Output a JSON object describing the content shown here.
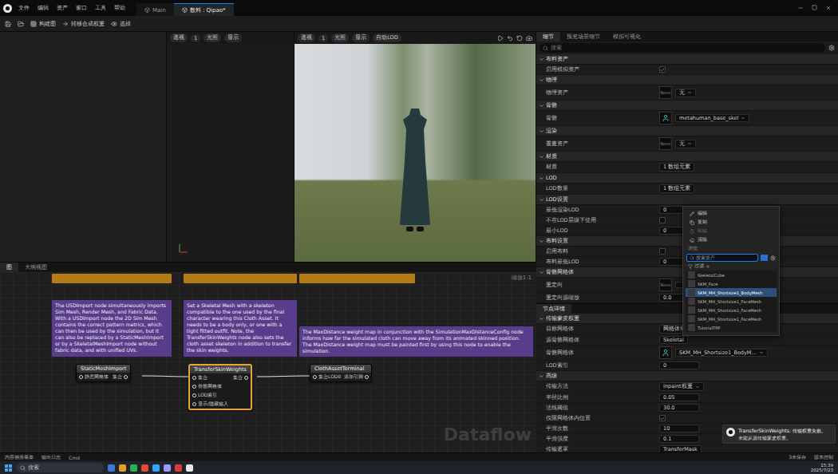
{
  "menu": [
    "文件",
    "编辑",
    "资产",
    "窗口",
    "工具",
    "帮助"
  ],
  "doc_tabs": [
    {
      "label": "Main",
      "selected": false
    },
    {
      "label": "数料 : Qipao*",
      "selected": true
    }
  ],
  "toolbar": [
    "构建图",
    "转移合成权重",
    "选择"
  ],
  "viewport_left": {
    "buttons": [
      "透视",
      "1",
      "光照",
      "显示"
    ]
  },
  "viewport_right": {
    "buttons": [
      "透视",
      "1",
      "光照",
      "显示",
      "自动LOD"
    ]
  },
  "graph": {
    "tabs": [
      {
        "label": "图",
        "selected": true
      },
      {
        "label": "大纲视图",
        "selected": false
      }
    ],
    "zoom": "缩放1:1",
    "watermark": "Dataflow",
    "comments": [
      "The USDImport node simultaneously imports Sim Mesh, Render Mesh, and Fabric Data. With a USDImport node the 2D Sim Mesh contains the correct pattern metrics, which can then be used by the simulation, but it can also be replaced by a StaticMeshImport or by a SkeletalMeshImport node without fabric data, and with unified UVs.",
      "Set a Skeletal Mesh with a skeleton compatible to the one used by the final character wearing this Cloth Asset. It needs to be a body only, or one with a tight fitted outfit. Note, the TransferSkinWeights node also sets the cloth asset skeleton in addition to transfer the skin weights.",
      "The MaxDistance weight map in conjunction with the SimulationMaxDistanceConfig node informs how far the simulated cloth can move away from its animated skinned position. The MaxDistance weight map must be painted first by using this node to enable the simulation."
    ],
    "nodes": [
      {
        "title": "StaticMeshImport",
        "selected": false,
        "inputs": [
          "静态网格体"
        ],
        "outputs": [
          "集合"
        ]
      },
      {
        "title": "TransferSkinWeights",
        "selected": true,
        "inputs": [
          "集合",
          "骨骼网格体",
          "LOD索引",
          "显示/隐藏输入"
        ],
        "outputs": [
          "集合"
        ]
      },
      {
        "title": "ClothAssetTerminal",
        "selected": false,
        "inputs": [
          "集合LOD0"
        ],
        "outputs": [
          "添加引脚"
        ]
      }
    ]
  },
  "details": {
    "tabs": [
      {
        "label": "细节",
        "selected": true
      },
      {
        "label": "预览场景细节",
        "selected": false
      },
      {
        "label": "模拟可视化",
        "selected": false
      }
    ],
    "search": "搜索",
    "rows": [
      {
        "kind": "header",
        "label": "布料资产"
      },
      {
        "kind": "check",
        "label": "启用模拟资产",
        "checked": true
      },
      {
        "kind": "header",
        "label": "物理"
      },
      {
        "kind": "asset",
        "label": "物理资产",
        "thumb": "None",
        "value": "无"
      },
      {
        "kind": "header",
        "label": "骨骼"
      },
      {
        "kind": "asset",
        "label": "骨骼",
        "thumb": "",
        "value": "metahuman_base_skel"
      },
      {
        "kind": "header",
        "label": "渲染"
      },
      {
        "kind": "asset",
        "label": "覆盖资产",
        "thumb": "None",
        "value": "无"
      },
      {
        "kind": "header",
        "label": "材质"
      },
      {
        "kind": "text",
        "label": "材质",
        "value": "1 数组元素"
      },
      {
        "kind": "header",
        "label": "LOD"
      },
      {
        "kind": "text",
        "label": "LOD数量",
        "value": "1 数组元素"
      },
      {
        "kind": "header",
        "label": "LOD设置"
      },
      {
        "kind": "number",
        "label": "最低渲染LOD",
        "value": "0"
      },
      {
        "kind": "check",
        "label": "不在LOD层级下使用",
        "checked": false
      },
      {
        "kind": "number",
        "label": "最小LOD",
        "value": "0"
      },
      {
        "kind": "header",
        "label": "布料设置"
      },
      {
        "kind": "check",
        "label": "启用布料",
        "checked": false
      },
      {
        "kind": "number",
        "label": "布料最低LOD",
        "value": "0"
      },
      {
        "kind": "header",
        "label": "骨骼网格体"
      },
      {
        "kind": "asset",
        "label": "重定向",
        "thumb": "None",
        "value": ""
      },
      {
        "kind": "number",
        "label": "重定向源缩放",
        "value": "0.0"
      }
    ]
  },
  "node_details": {
    "title": "节点详情",
    "rows": [
      {
        "kind": "header",
        "label": "传输蒙皮权重"
      },
      {
        "kind": "text",
        "label": "目标网格体",
        "value": "网格体集合"
      },
      {
        "kind": "text",
        "label": "源骨骼网格体",
        "value": "Skeletal"
      },
      {
        "kind": "asset",
        "label": "骨骼网格体",
        "thumb": "",
        "value": "SKM_MH_Shortsize1_BodyM..."
      },
      {
        "kind": "number",
        "label": "LOD索引",
        "value": "0"
      },
      {
        "kind": "header",
        "label": "高级"
      },
      {
        "kind": "select",
        "label": "传输方法",
        "value": "Inpaint权重"
      },
      {
        "kind": "number",
        "label": "半径比例",
        "value": "0.05"
      },
      {
        "kind": "number",
        "label": "法线阈值",
        "value": "30.0"
      },
      {
        "kind": "check",
        "label": "仅限网格体内位置",
        "checked": true
      },
      {
        "kind": "number",
        "label": "平滑次数",
        "value": "10"
      },
      {
        "kind": "number",
        "label": "平滑强度",
        "value": "0.1"
      },
      {
        "kind": "text",
        "label": "传输遮罩",
        "value": "TransferMask"
      }
    ]
  },
  "asset_picker": {
    "actions": [
      {
        "label": "编辑",
        "disabled": false
      },
      {
        "label": "复制",
        "disabled": false
      },
      {
        "label": "粘贴",
        "disabled": true
      },
      {
        "label": "清除",
        "disabled": false
      }
    ],
    "section": "浏览",
    "search": "搜索资产",
    "filter": "过滤",
    "items": [
      {
        "label": "SkeletalCube",
        "selected": false
      },
      {
        "label": "SKM_Face",
        "selected": false
      },
      {
        "label": "SKM_MH_Shortsize1_BodyMesh",
        "selected": true
      },
      {
        "label": "SKM_MH_Shortsize1_FaceMesh",
        "selected": false
      },
      {
        "label": "SKM_MH_Shortsize1_FaceMesh",
        "selected": false
      },
      {
        "label": "SKM_MH_Shortsize1_FaceMesh",
        "selected": false
      },
      {
        "label": "TutorialTPP",
        "selected": false
      }
    ]
  },
  "toast": {
    "title": "TransferSkinWeights: 传输权重失败。",
    "body": "未能从源传输蒙皮权重。"
  },
  "status_bar": {
    "left": [
      "内容侧滑菜单",
      "输出日志",
      "Cmd"
    ],
    "right": [
      "3未保存",
      "版本控制"
    ]
  },
  "taskbar": {
    "search": "搜索",
    "time": "15:39",
    "date": "2025/7/23"
  }
}
